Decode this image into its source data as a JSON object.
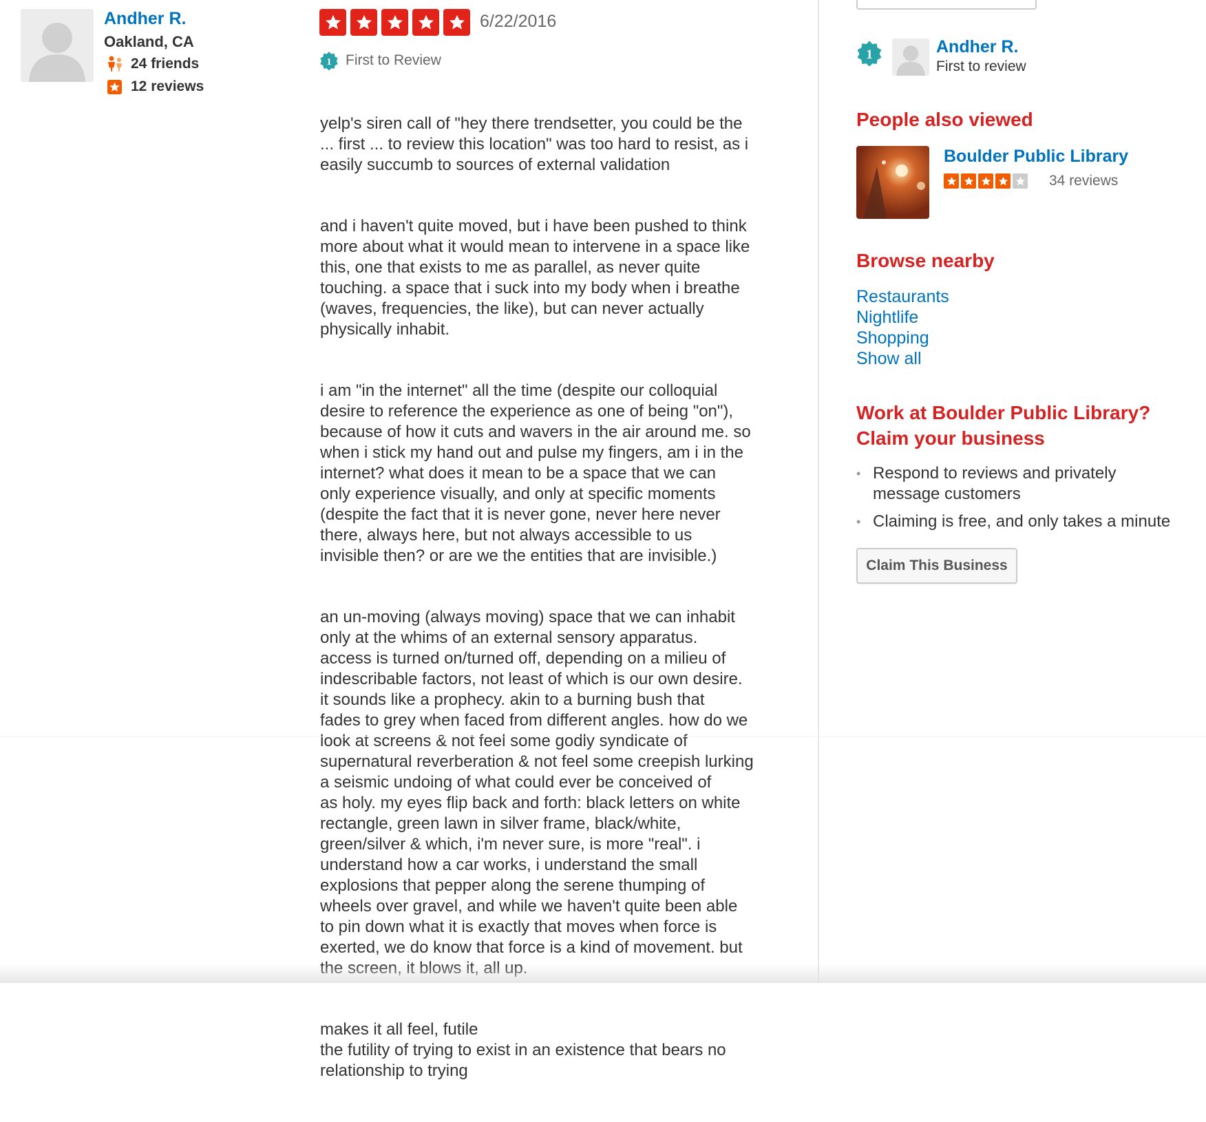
{
  "reviewer": {
    "name": "Andher R.",
    "location": "Oakland, CA",
    "friends": "24 friends",
    "reviews": "12 reviews",
    "friends_icon": "friends-icon",
    "reviews_icon": "review-star-icon"
  },
  "review": {
    "rating": 5,
    "date": "6/22/2016",
    "first_to_review": "First to Review",
    "paragraphs": [
      "yelp's siren call of \"hey there trendsetter, you could be the\n... first ... to review this location\" was too hard to resist, as i\neasily succumb to sources of external validation",
      "and i haven't quite moved, but i have been pushed to think\nmore about what it would mean to intervene in a space like\nthis, one that exists to me as parallel, as never quite\ntouching. a space that i suck into my body when i breathe\n(waves, frequencies, the like), but can never actually\nphysically inhabit.",
      "i am \"in the internet\" all the time (despite our colloquial\ndesire to reference the experience as one of being \"on\"),\nbecause of how it cuts and wavers in the air around me. so\nwhen i stick my hand out and pulse my fingers, am i in the\ninternet? what does it mean to be a space that we can\nonly experience visually, and only at specific moments\n(despite the fact that it is never gone, never here never\nthere, always here, but not always accessible to us\n invisible then? or are we the entities that are  invisible.)",
      "an un-moving (always moving) space that we can inhabit\nonly at the whims of an external sensory apparatus.\naccess is turned on/turned off, depending on a milieu of\nindescribable factors, not least of which is our own desire.\nit sounds like      a prophecy. akin to a burning bush that\nfades to grey when faced from different angles. how do we\nlook at screens & not feel some godly syndicate of\nsupernatural reverberation & not feel some creepish lurking\n    a seismic undoing of what could ever be conceived of\nas holy. my eyes flip back and forth: black letters on white\nrectangle, green lawn in silver frame, black/white,\ngreen/silver & which, i'm never sure, is more \"real\". i\nunderstand how a car works, i understand the small\nexplosions that pepper along the serene thumping of\nwheels over gravel, and while we haven't quite been able\nto pin down what it is exactly that moves when force is\nexerted, we do know that force is a kind of movement. but\nthe screen, it blows it, all up.",
      "makes it all feel,       futile\nthe futility of trying to exist in an existence that bears no\nrelationship to trying"
    ]
  },
  "sidebar": {
    "first_reviewer": {
      "name": "Andher R.",
      "subtitle": "First to review",
      "badge_number": "1"
    },
    "people_also_viewed": {
      "heading": "People also viewed",
      "business": {
        "name": "Boulder Public Library",
        "rating": 4,
        "reviews": "34 reviews"
      }
    },
    "browse_nearby": {
      "heading": "Browse nearby",
      "links": [
        "Restaurants",
        "Nightlife",
        "Shopping",
        "Show all"
      ]
    },
    "claim": {
      "heading_line1": "Work at Boulder Public Library?",
      "heading_line2": "Claim your business",
      "bullets": [
        "Respond to reviews and privately\nmessage customers",
        "Claiming is free, and only takes a minute"
      ],
      "button": "Claim This Business"
    }
  },
  "colors": {
    "link_blue": "#0073bb",
    "yelp_red": "#d32323",
    "star_red": "#e2231a",
    "star_orange": "#f15c00",
    "badge_teal": "#2aa3a8"
  }
}
